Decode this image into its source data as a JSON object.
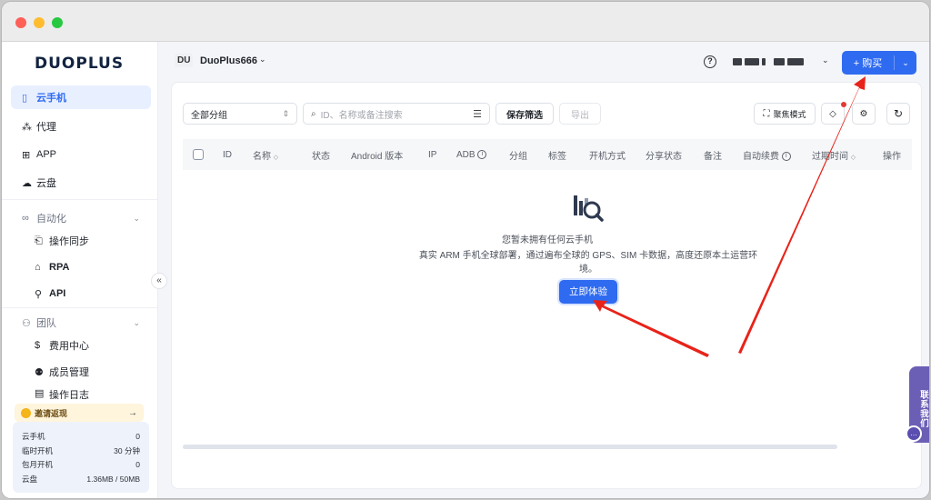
{
  "brand": {
    "logo_text": "DUOPLUS"
  },
  "sidebar": {
    "items": [
      {
        "label": "云手机",
        "icon": "phone-icon"
      },
      {
        "label": "代理",
        "icon": "proxy-icon"
      },
      {
        "label": "APP",
        "icon": "apps-grid-icon"
      },
      {
        "label": "云盘",
        "icon": "cloud-icon"
      }
    ],
    "automation": {
      "label": "自动化",
      "children": [
        {
          "label": "操作同步",
          "icon": "sync-icon"
        },
        {
          "label": "RPA",
          "icon": "robot-icon"
        },
        {
          "label": "API",
          "icon": "api-icon"
        }
      ]
    },
    "team": {
      "label": "团队",
      "children": [
        {
          "label": "费用中心",
          "icon": "dollar-icon"
        },
        {
          "label": "成员管理",
          "icon": "members-icon"
        },
        {
          "label": "操作日志",
          "icon": "log-icon"
        }
      ]
    },
    "invite": {
      "label": "邀请返现",
      "arrow": "→"
    },
    "stats": [
      {
        "label": "云手机",
        "value": "0"
      },
      {
        "label": "临时开机",
        "value": "30 分钟"
      },
      {
        "label": "包月开机",
        "value": "0"
      },
      {
        "label": "云盘",
        "value": "1.36MB / 50MB"
      }
    ]
  },
  "header": {
    "workspace_badge": "DU",
    "workspace_name": "DuoPlus666",
    "buy_label": "+ 购买"
  },
  "toolbar": {
    "group_select": "全部分组",
    "search_placeholder": "ID、名称或备注搜索",
    "save_filter": "保存筛选",
    "export": "导出",
    "focus_mode": "聚焦模式"
  },
  "table": {
    "columns": [
      "ID",
      "名称",
      "状态",
      "Android 版本",
      "IP",
      "ADB",
      "分组",
      "标签",
      "开机方式",
      "分享状态",
      "备注",
      "自动续费",
      "过期时间",
      "操作"
    ]
  },
  "empty_state": {
    "title": "您暂未拥有任何云手机",
    "description": "真实 ARM 手机全球部署，通过遍布全球的 GPS、SIM 卡数据，高度还原本土运营环境。",
    "button": "立即体验"
  },
  "contact": {
    "label": "联系我们"
  },
  "colors": {
    "accent": "#2f6bf0",
    "annotation_arrow": "#e8231a",
    "contact": "#6b5fb5"
  }
}
